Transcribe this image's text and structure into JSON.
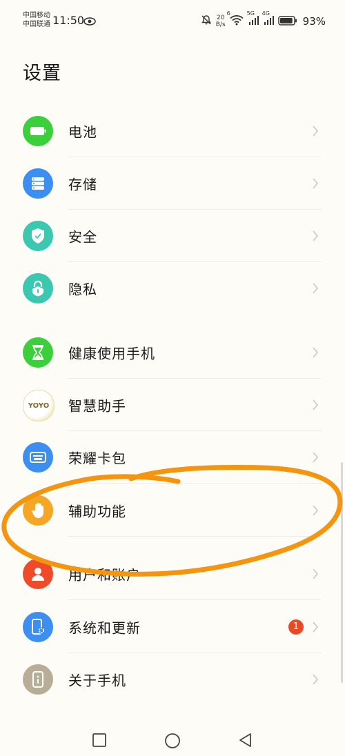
{
  "status_bar": {
    "carrier_1": "中国移动",
    "carrier_2": "中国联通",
    "time": "11:50",
    "speed_value": "20",
    "speed_unit": "B/s",
    "net_1": "6",
    "net_2": "5G",
    "net_3": "4G",
    "battery_percent": "93%",
    "battery_level": 0.93,
    "icons": [
      "eye-icon",
      "mute-bell-icon",
      "wifi-icon",
      "signal-icon",
      "battery-icon"
    ]
  },
  "title": "设置",
  "items": [
    {
      "label": "电池",
      "icon": "battery-icon",
      "color": "#3ccf3c"
    },
    {
      "label": "存储",
      "icon": "storage-icon",
      "color": "#3c8ff0"
    },
    {
      "label": "安全",
      "icon": "shield-icon",
      "color": "#3cc8b0"
    },
    {
      "label": "隐私",
      "icon": "privacy-lock-icon",
      "color": "#3cc8b0"
    },
    {
      "label": "健康使用手机",
      "icon": "hourglass-icon",
      "color": "#3ccf3c"
    },
    {
      "label": "智慧助手",
      "icon": "yoyo-icon",
      "icon_text": "YOYO",
      "color": "#e8d27a"
    },
    {
      "label": "荣耀卡包",
      "icon": "wallet-icon",
      "color": "#3c8ff0"
    },
    {
      "label": "辅助功能",
      "icon": "hand-icon",
      "color": "#f5a623"
    },
    {
      "label": "用户和账户",
      "icon": "user-icon",
      "color": "#ef4b2b"
    },
    {
      "label": "系统和更新",
      "icon": "system-update-icon",
      "color": "#3c8ff0",
      "badge": "1"
    },
    {
      "label": "关于手机",
      "icon": "phone-info-icon",
      "color": "#b8ad97"
    }
  ],
  "annotation_color": "#f5940f",
  "nav": [
    "recents-button",
    "home-button",
    "back-button"
  ]
}
